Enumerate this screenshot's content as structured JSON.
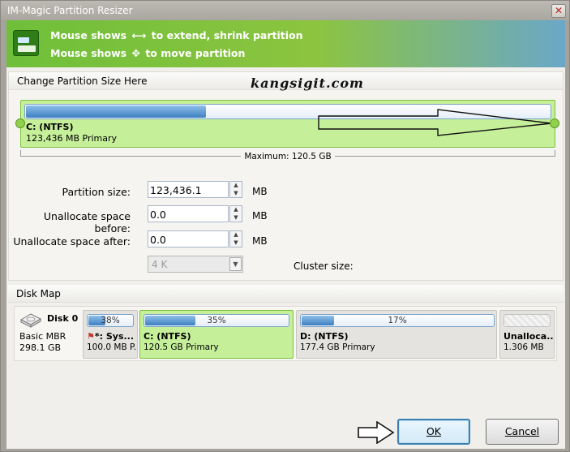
{
  "window": {
    "title": "IM-Magic Partition Resizer",
    "close_glyph": "✕"
  },
  "banner": {
    "line1_pre": "Mouse shows",
    "line1_glyph": "⟷",
    "line1_post": "to extend, shrink partition",
    "line2_pre": "Mouse shows",
    "line2_glyph": "✥",
    "line2_post": "to move partition"
  },
  "resize_section": {
    "title": "Change Partition Size Here",
    "watermark": "kangsigit.com",
    "partition": {
      "name": "C: (NTFS)",
      "info": "123,436 MB Primary",
      "used_fraction": 0.34
    },
    "maximum_label": "Maximum: 120.5 GB",
    "fields": {
      "size_label": "Partition size:",
      "size_value": "123,436.1",
      "size_unit": "MB",
      "before_label": "Unallocate space before:",
      "before_value": "0.0",
      "before_unit": "MB",
      "after_label": "Unallocate space after:",
      "after_value": "0.0",
      "after_unit": "MB",
      "cluster_value": "4 K",
      "cluster_label": "Cluster size:"
    }
  },
  "disk_map": {
    "title": "Disk Map",
    "disk": {
      "name": "Disk 0",
      "type": "Basic MBR",
      "size": "298.1 GB"
    },
    "partitions": [
      {
        "percent": "38%",
        "fill": 0.38,
        "name": "*: Sys...",
        "info": "100.0 MB P."
      },
      {
        "percent": "35%",
        "fill": 0.35,
        "name": "C: (NTFS)",
        "info": "120.5 GB Primary"
      },
      {
        "percent": "17%",
        "fill": 0.17,
        "name": "D: (NTFS)",
        "info": "177.4 GB Primary"
      },
      {
        "percent": "",
        "fill": 0,
        "name": "Unalloca...",
        "info": "1.306 MB"
      }
    ]
  },
  "buttons": {
    "ok_label": "OK",
    "cancel_label": "Cancel"
  },
  "colors": {
    "partition_green": "#c6ef9a",
    "bar_blue": "#3d7fc0",
    "banner_green": "#8cc43f"
  }
}
